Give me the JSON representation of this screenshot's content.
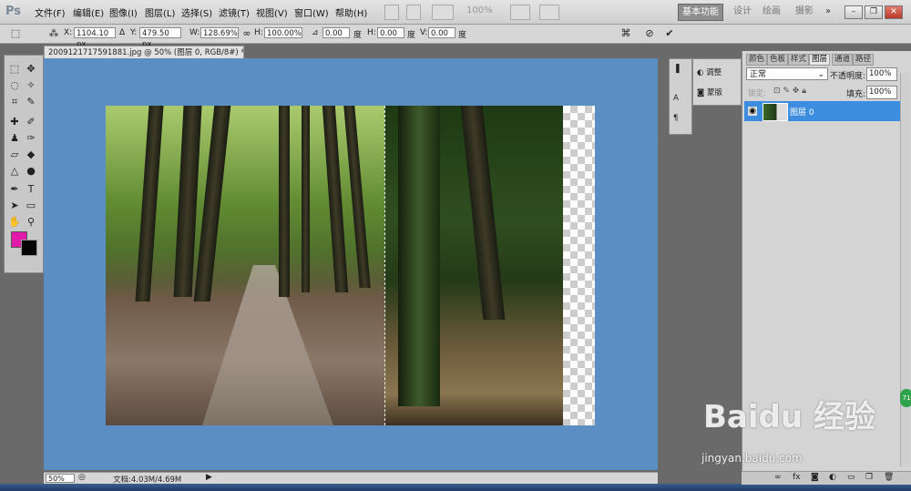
{
  "app": {
    "logo": "Ps"
  },
  "menu": [
    "文件(F)",
    "编辑(E)",
    "图像(I)",
    "图层(L)",
    "选择(S)",
    "滤镜(T)",
    "视图(V)",
    "窗口(W)",
    "帮助(H)"
  ],
  "menubar": {
    "zoom": "100%"
  },
  "workspaces": [
    "基本功能",
    "设计",
    "绘画",
    "摄影",
    "»"
  ],
  "options": {
    "x_label": "X:",
    "x_value": "1104.10 px",
    "y_label": "Y:",
    "y_value": "479.50 px",
    "w_label": "W:",
    "w_value": "128.69%",
    "h_label": "H:",
    "h_value": "100.00%",
    "rot_value": "0.00",
    "rot_unit": "度",
    "hskew_label": "H:",
    "hskew_value": "0.00",
    "hskew_unit": "度",
    "vskew_label": "V:",
    "vskew_value": "0.00",
    "vskew_unit": "度"
  },
  "document": {
    "tab_title": "2009121717591881.jpg @ 50% (图层 0, RGB/8#) *",
    "zoom": "50%",
    "doc_info": "文档:4.03M/4.69M"
  },
  "mini_panels": {
    "adjust": "调整",
    "mask": "蒙版"
  },
  "layers_panel": {
    "tabs": [
      "颜色",
      "色板",
      "样式",
      "图层",
      "通道",
      "路径"
    ],
    "active_tab": "图层",
    "blend_mode": "正常",
    "opacity_label": "不透明度:",
    "opacity_value": "100%",
    "lock_label": "锁定:",
    "fill_label": "填充:",
    "fill_value": "100%",
    "layers": [
      {
        "name": "图层 0"
      }
    ]
  },
  "badge": "71",
  "watermark": {
    "logo": "Baidu 经验",
    "url": "jingyan.baidu.com"
  },
  "colors": {
    "foreground": "#e21aa9",
    "background": "#050505",
    "canvas_bg": "#5b8ec2",
    "layer_selected": "#3c8de0"
  }
}
